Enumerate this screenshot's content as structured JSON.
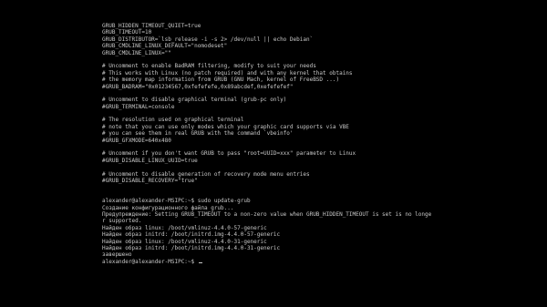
{
  "terminal": {
    "lines": [
      "GRUB_HIDDEN_TIMEOUT_QUIET=true",
      "GRUB_TIMEOUT=10",
      "GRUB_DISTRIBUTOR=`lsb_release -i -s 2> /dev/null || echo Debian`",
      "GRUB_CMDLINE_LINUX_DEFAULT=\"nomodeset\"",
      "GRUB_CMDLINE_LINUX=\"\"",
      "",
      "# Uncomment to enable BadRAM filtering, modify to suit your needs",
      "# This works with Linux (no patch required) and with any kernel that obtains",
      "# the memory map information from GRUB (GNU Mach, kernel of FreeBSD ...)",
      "#GRUB_BADRAM=\"0x01234567,0xfefefefe,0x89abcdef,0xefefefef\"",
      "",
      "# Uncomment to disable graphical terminal (grub-pc only)",
      "#GRUB_TERMINAL=console",
      "",
      "# The resolution used on graphical terminal",
      "# note that you can use only modes which your graphic card supports via VBE",
      "# you can see them in real GRUB with the command `vbeinfo'",
      "#GRUB_GFXMODE=640x480",
      "",
      "# Uncomment if you don't want GRUB to pass \"root=UUID=xxx\" parameter to Linux",
      "#GRUB_DISABLE_LINUX_UUID=true",
      "",
      "# Uncomment to disable generation of recovery mode menu entries",
      "#GRUB_DISABLE_RECOVERY=\"true\"",
      "",
      "",
      "alexander@alexander-MSIPC:~$ sudo update-grub",
      "Создание конфигурационного файла grub...",
      "Предупреждение: Setting GRUB_TIMEOUT to a non-zero value when GRUB_HIDDEN_TIMEOUT is set is no longe",
      "r supported.",
      "Найден образ linux: /boot/vmlinuz-4.4.0-57-generic",
      "Найден образ initrd: /boot/initrd.img-4.4.0-57-generic",
      "Найден образ linux: /boot/vmlinuz-4.4.0-31-generic",
      "Найден образ initrd: /boot/initrd.img-4.4.0-31-generic",
      "завершено"
    ],
    "prompt": "alexander@alexander-MSIPC:~$ ",
    "colors": {
      "background": "#000000",
      "foreground": "#c8c8c8"
    }
  }
}
